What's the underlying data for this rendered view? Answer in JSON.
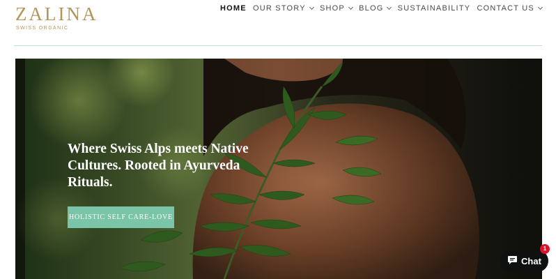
{
  "brand": {
    "name": "ZALINA",
    "tagline": "SWISS ORGANIC"
  },
  "nav": {
    "items": [
      {
        "label": "HOME",
        "dropdown": false,
        "active": true
      },
      {
        "label": "OUR STORY",
        "dropdown": true
      },
      {
        "label": "SHOP",
        "dropdown": true
      },
      {
        "label": "BLOG",
        "dropdown": true
      },
      {
        "label": "SUSTAINABILITY",
        "dropdown": false
      },
      {
        "label": "CONTACT US",
        "dropdown": true
      }
    ]
  },
  "hero": {
    "title": "Where Swiss Alps meets Native Cultures. Rooted in Ayurveda Rituals.",
    "button_label": "HOLISTIC SELF CARE-LOVE"
  },
  "chat": {
    "label": "Chat",
    "badge": "1"
  },
  "colors": {
    "brand_gold": "#b5955a",
    "accent_mint": "#7ac4a7",
    "header_rule": "#bfe0d6",
    "chat_bg": "#0f1110",
    "badge_red": "#e0102b"
  },
  "icons": {
    "chat": "chat-bubble-icon",
    "dropdown": "chevron-down-icon"
  }
}
